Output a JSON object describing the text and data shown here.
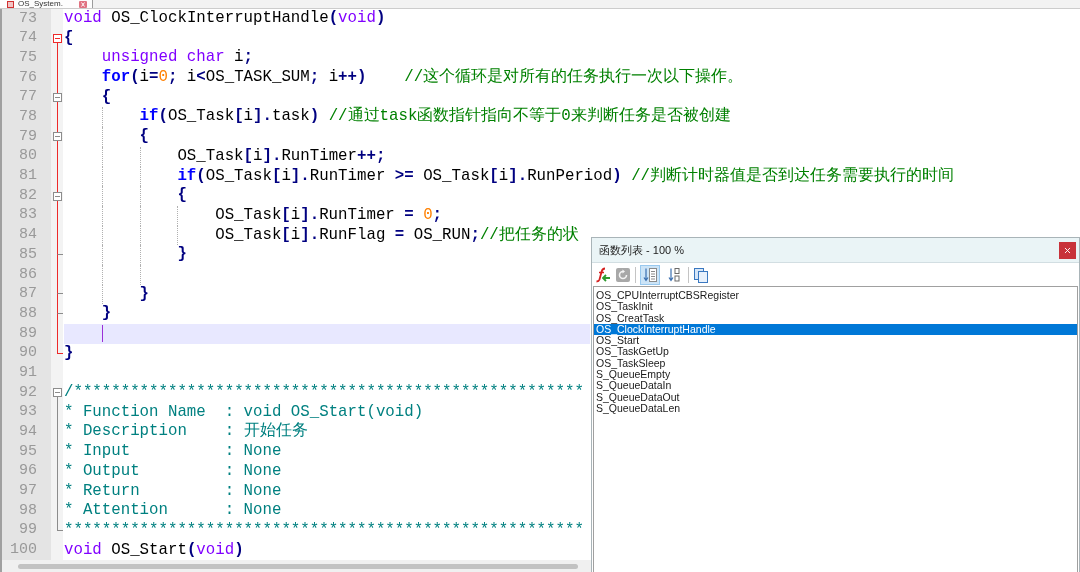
{
  "tab": {
    "label": "OS_System."
  },
  "editor": {
    "lines": [
      {
        "number": "73",
        "current": false,
        "tokens": [
          {
            "text": "void",
            "kind": "type"
          },
          {
            "text": " OS_ClockInterruptHandle",
            "kind": "plain"
          },
          {
            "text": "(",
            "kind": "operator"
          },
          {
            "text": "void",
            "kind": "type"
          },
          {
            "text": ")",
            "kind": "operator"
          }
        ]
      },
      {
        "number": "74",
        "current": false,
        "fold": {
          "kind": "start"
        },
        "tokens": [
          {
            "text": "{",
            "kind": "operator"
          }
        ]
      },
      {
        "number": "75",
        "current": false,
        "tokens": [
          {
            "text": "    unsigned char",
            "kind": "type"
          },
          {
            "text": " i",
            "kind": "plain"
          },
          {
            "text": ";",
            "kind": "operator"
          }
        ]
      },
      {
        "number": "76",
        "current": false,
        "tokens": [
          {
            "text": "    for",
            "kind": "keyword"
          },
          {
            "text": "(",
            "kind": "operator"
          },
          {
            "text": "i",
            "kind": "plain"
          },
          {
            "text": "=",
            "kind": "operator"
          },
          {
            "text": "0",
            "kind": "number"
          },
          {
            "text": ";",
            "kind": "operator"
          },
          {
            "text": " i",
            "kind": "plain"
          },
          {
            "text": "<",
            "kind": "operator"
          },
          {
            "text": "OS_TASK_SUM",
            "kind": "plain"
          },
          {
            "text": ";",
            "kind": "operator"
          },
          {
            "text": " i",
            "kind": "plain"
          },
          {
            "text": "++)",
            "kind": "operator"
          },
          {
            "text": "    //这个循环是对所有的任务执行一次以下操作。",
            "kind": "comment"
          }
        ]
      },
      {
        "number": "77",
        "current": false,
        "fold": {
          "kind": "start"
        },
        "tokens": [
          {
            "text": "    {",
            "kind": "operator"
          }
        ]
      },
      {
        "number": "78",
        "current": false,
        "tokens": [
          {
            "text": "        if",
            "kind": "keyword"
          },
          {
            "text": "(",
            "kind": "operator"
          },
          {
            "text": "OS_Task",
            "kind": "plain"
          },
          {
            "text": "[",
            "kind": "operator"
          },
          {
            "text": "i",
            "kind": "plain"
          },
          {
            "text": "].",
            "kind": "operator"
          },
          {
            "text": "task",
            "kind": "plain"
          },
          {
            "text": ")",
            "kind": "operator"
          },
          {
            "text": " //通过task函数指针指向不等于0来判断任务是否被创建",
            "kind": "comment"
          }
        ]
      },
      {
        "number": "79",
        "current": false,
        "fold": {
          "kind": "start"
        },
        "tokens": [
          {
            "text": "        {",
            "kind": "operator"
          }
        ]
      },
      {
        "number": "80",
        "current": false,
        "tokens": [
          {
            "text": "            OS_Task",
            "kind": "plain"
          },
          {
            "text": "[",
            "kind": "operator"
          },
          {
            "text": "i",
            "kind": "plain"
          },
          {
            "text": "].",
            "kind": "operator"
          },
          {
            "text": "RunTimer",
            "kind": "plain"
          },
          {
            "text": "++;",
            "kind": "operator"
          }
        ]
      },
      {
        "number": "81",
        "current": false,
        "tokens": [
          {
            "text": "            if",
            "kind": "keyword"
          },
          {
            "text": "(",
            "kind": "operator"
          },
          {
            "text": "OS_Task",
            "kind": "plain"
          },
          {
            "text": "[",
            "kind": "operator"
          },
          {
            "text": "i",
            "kind": "plain"
          },
          {
            "text": "].",
            "kind": "operator"
          },
          {
            "text": "RunTimer ",
            "kind": "plain"
          },
          {
            "text": ">=",
            "kind": "operator"
          },
          {
            "text": " OS_Task",
            "kind": "plain"
          },
          {
            "text": "[",
            "kind": "operator"
          },
          {
            "text": "i",
            "kind": "plain"
          },
          {
            "text": "].",
            "kind": "operator"
          },
          {
            "text": "RunPeriod",
            "kind": "plain"
          },
          {
            "text": ")",
            "kind": "operator"
          },
          {
            "text": " //判断计时器值是否到达任务需要执行的时间",
            "kind": "comment"
          }
        ]
      },
      {
        "number": "82",
        "current": false,
        "fold": {
          "kind": "start"
        },
        "tokens": [
          {
            "text": "            {",
            "kind": "operator"
          }
        ]
      },
      {
        "number": "83",
        "current": false,
        "tokens": [
          {
            "text": "                OS_Task",
            "kind": "plain"
          },
          {
            "text": "[",
            "kind": "operator"
          },
          {
            "text": "i",
            "kind": "plain"
          },
          {
            "text": "].",
            "kind": "operator"
          },
          {
            "text": "RunTimer ",
            "kind": "plain"
          },
          {
            "text": "=",
            "kind": "operator"
          },
          {
            "text": " 0",
            "kind": "number"
          },
          {
            "text": ";",
            "kind": "operator"
          }
        ]
      },
      {
        "number": "84",
        "current": false,
        "tokens": [
          {
            "text": "                OS_Task",
            "kind": "plain"
          },
          {
            "text": "[",
            "kind": "operator"
          },
          {
            "text": "i",
            "kind": "plain"
          },
          {
            "text": "].",
            "kind": "operator"
          },
          {
            "text": "RunFlag ",
            "kind": "plain"
          },
          {
            "text": "=",
            "kind": "operator"
          },
          {
            "text": " OS_RUN",
            "kind": "plain"
          },
          {
            "text": ";",
            "kind": "operator"
          },
          {
            "text": "//把任务的状",
            "kind": "comment"
          }
        ]
      },
      {
        "number": "85",
        "current": false,
        "fold": {
          "kind": "end"
        },
        "tokens": [
          {
            "text": "            }",
            "kind": "operator"
          }
        ]
      },
      {
        "number": "86",
        "current": false
      },
      {
        "number": "87",
        "current": false,
        "fold": {
          "kind": "end"
        },
        "tokens": [
          {
            "text": "        }",
            "kind": "operator"
          }
        ]
      },
      {
        "number": "88",
        "current": false,
        "fold": {
          "kind": "end"
        },
        "tokens": [
          {
            "text": "    }",
            "kind": "operator"
          }
        ]
      },
      {
        "number": "89",
        "current": true
      },
      {
        "number": "90",
        "current": false,
        "fold": {
          "kind": "end"
        },
        "tokens": [
          {
            "text": "}",
            "kind": "operator"
          }
        ]
      },
      {
        "number": "91",
        "current": false
      },
      {
        "number": "92",
        "current": false,
        "fold": {
          "kind": "start"
        },
        "tokens": [
          {
            "text": "/******************************************************",
            "kind": "doc"
          }
        ]
      },
      {
        "number": "93",
        "current": false,
        "tokens": [
          {
            "text": "* Function Name  : void OS_Start(void)",
            "kind": "doc"
          }
        ]
      },
      {
        "number": "94",
        "current": false,
        "tokens": [
          {
            "text": "* Description    : 开始任务",
            "kind": "doc"
          }
        ]
      },
      {
        "number": "95",
        "current": false,
        "tokens": [
          {
            "text": "* Input          : None",
            "kind": "doc"
          }
        ]
      },
      {
        "number": "96",
        "current": false,
        "tokens": [
          {
            "text": "* Output         : None",
            "kind": "doc"
          }
        ]
      },
      {
        "number": "97",
        "current": false,
        "tokens": [
          {
            "text": "* Return         : None",
            "kind": "doc"
          }
        ]
      },
      {
        "number": "98",
        "current": false,
        "tokens": [
          {
            "text": "* Attention      : None",
            "kind": "doc"
          }
        ]
      },
      {
        "number": "99",
        "current": false,
        "fold": {
          "kind": "end"
        },
        "tokens": [
          {
            "text": "*******************************************************",
            "kind": "doc"
          }
        ]
      },
      {
        "number": "100",
        "current": false,
        "tokens": [
          {
            "text": "void",
            "kind": "type"
          },
          {
            "text": " OS_Start",
            "kind": "plain"
          },
          {
            "text": "(",
            "kind": "operator"
          },
          {
            "text": "void",
            "kind": "type"
          },
          {
            "text": ")",
            "kind": "operator"
          }
        ]
      }
    ]
  },
  "function_list": {
    "title": "函数列表 - 100 %",
    "sort_buttons": [
      {
        "selected": true
      },
      {
        "selected": false
      }
    ],
    "items": [
      {
        "label": "OS_CPUInterruptCBSRegister",
        "selected": false
      },
      {
        "label": "OS_TaskInit",
        "selected": false
      },
      {
        "label": "OS_CreatTask",
        "selected": false
      },
      {
        "label": "OS_ClockInterruptHandle",
        "selected": true
      },
      {
        "label": "OS_Start",
        "selected": false
      },
      {
        "label": "OS_TaskGetUp",
        "selected": false
      },
      {
        "label": "OS_TaskSleep",
        "selected": false
      },
      {
        "label": "S_QueueEmpty",
        "selected": false
      },
      {
        "label": "S_QueueDataIn",
        "selected": false
      },
      {
        "label": "S_QueueDataOut",
        "selected": false
      },
      {
        "label": "S_QueueDataLen",
        "selected": false
      }
    ]
  }
}
